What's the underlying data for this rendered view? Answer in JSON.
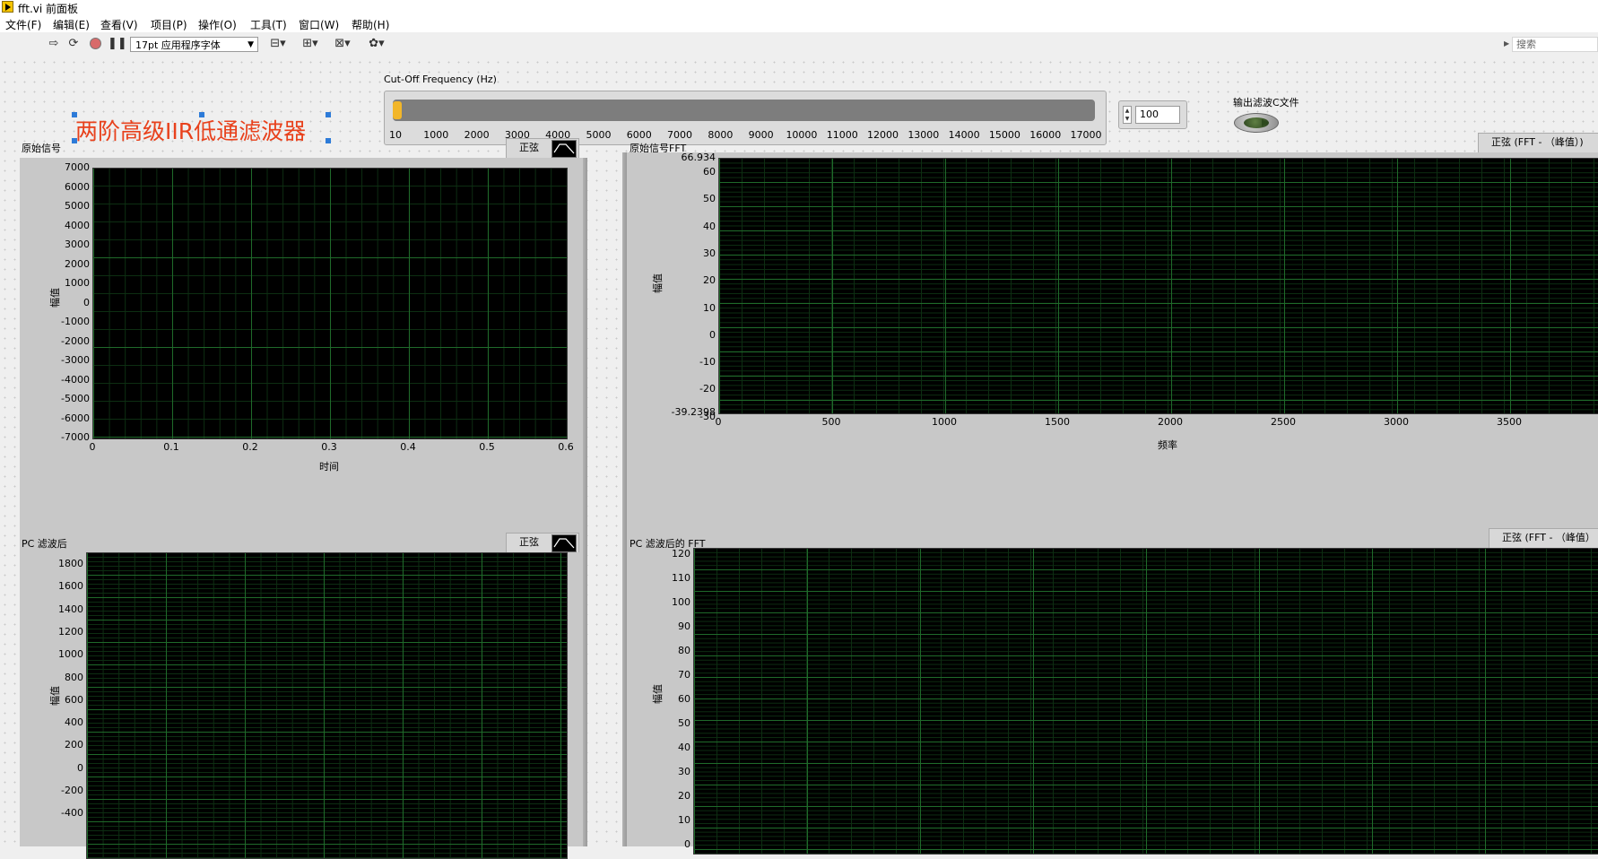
{
  "window": {
    "title": "fft.vi 前面板"
  },
  "menu": [
    "文件(F)",
    "编辑(E)",
    "查看(V)",
    "项目(P)",
    "操作(O)",
    "工具(T)",
    "窗口(W)",
    "帮助(H)"
  ],
  "toolbar": {
    "font": "17pt 应用程序字体",
    "search_placeholder": "搜索",
    "icons": [
      "run-arrow-icon",
      "run-continuous-icon",
      "abort-icon",
      "pause-icon",
      "align-icon",
      "distribute-icon",
      "resize-icon",
      "reorder-icon",
      "cleanup-icon"
    ]
  },
  "decoration": {
    "title": "两阶高级IIR低通滤波器",
    "color": "#e8411c"
  },
  "cutoff": {
    "label": "Cut-Off Frequency (Hz)",
    "ticks": [
      "10",
      "1000",
      "2000",
      "3000",
      "4000",
      "5000",
      "6000",
      "7000",
      "8000",
      "9000",
      "10000",
      "11000",
      "12000",
      "13000",
      "14000",
      "15000",
      "16000",
      "17000"
    ],
    "value": "100",
    "fill_color": "#f2b629"
  },
  "led": {
    "label": "输出滤波C文件"
  },
  "graphs": {
    "raw": {
      "title": "原始信号",
      "legend": "正弦",
      "xlabel": "时间",
      "ylabel": "幅值",
      "yticks": [
        "7000",
        "6000",
        "5000",
        "4000",
        "3000",
        "2000",
        "1000",
        "0",
        "-1000",
        "-2000",
        "-3000",
        "-4000",
        "-5000",
        "-6000",
        "-7000"
      ],
      "xticks": [
        "0",
        "0.1",
        "0.2",
        "0.3",
        "0.4",
        "0.5",
        "0.6"
      ],
      "palette": [
        "cursor-icon",
        "zoom-icon",
        "pan-icon"
      ]
    },
    "raw_fft": {
      "title": "原始信号FFT",
      "legend": "正弦 (FFT - （峰值）)",
      "xlabel": "频率",
      "ylabel": "幅值",
      "ymax": "66.934",
      "ymin": "-39.2398",
      "yticks": [
        "60",
        "50",
        "40",
        "30",
        "20",
        "10",
        "0",
        "-10",
        "-20",
        "-30"
      ],
      "xticks": [
        "0",
        "500",
        "1000",
        "1500",
        "2000",
        "2500",
        "3000",
        "3500"
      ],
      "palette": [
        "cursor-icon",
        "zoom-icon",
        "pan-icon"
      ]
    },
    "filtered": {
      "title": "PC 滤波后",
      "legend": "正弦",
      "ylabel": "幅值",
      "yticks": [
        "1800",
        "1600",
        "1400",
        "1200",
        "1000",
        "800",
        "600",
        "400",
        "200",
        "0",
        "-200",
        "-400"
      ]
    },
    "filtered_fft": {
      "title": "PC 滤波后的 FFT",
      "legend": "正弦 (FFT - （峰值）",
      "ylabel": "幅值",
      "yticks": [
        "120",
        "110",
        "100",
        "90",
        "80",
        "70",
        "60",
        "50",
        "40",
        "30",
        "20",
        "10",
        "0"
      ]
    }
  },
  "colors": {
    "plot_bg": "#000000",
    "grid_major": "#1f6a2a",
    "grid_minor": "#0d2e12"
  }
}
